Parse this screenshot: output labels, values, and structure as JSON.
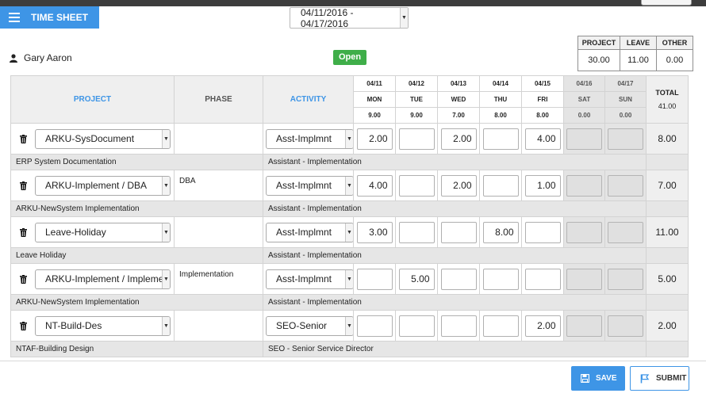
{
  "header": {
    "title": "TIME SHEET",
    "period": "04/11/2016 - 04/17/2016",
    "user": "Gary Aaron",
    "status": "Open"
  },
  "summary": {
    "labels": [
      "PROJECT",
      "LEAVE",
      "OTHER"
    ],
    "values": [
      "30.00",
      "11.00",
      "0.00"
    ]
  },
  "grid": {
    "columns": {
      "project": "PROJECT",
      "phase": "PHASE",
      "activity": "ACTIVITY",
      "total": "TOTAL"
    },
    "grand_total": "41.00",
    "days": [
      {
        "date": "04/11",
        "dow": "MON",
        "total": "9.00"
      },
      {
        "date": "04/12",
        "dow": "TUE",
        "total": "9.00"
      },
      {
        "date": "04/13",
        "dow": "WED",
        "total": "7.00"
      },
      {
        "date": "04/14",
        "dow": "THU",
        "total": "8.00"
      },
      {
        "date": "04/15",
        "dow": "FRI",
        "total": "8.00"
      },
      {
        "date": "04/16",
        "dow": "SAT",
        "total": "0.00"
      },
      {
        "date": "04/17",
        "dow": "SUN",
        "total": "0.00"
      }
    ],
    "rows": [
      {
        "project": "ARKU-SysDocument",
        "phase": "",
        "activity": "Asst-Implmnt",
        "hours": [
          "2.00",
          "",
          "2.00",
          "",
          "4.00",
          "",
          ""
        ],
        "total": "8.00",
        "project_desc": "ERP System Documentation",
        "activity_desc": "Assistant - Implementation"
      },
      {
        "project": "ARKU-Implement / DBA",
        "phase": "DBA",
        "activity": "Asst-Implmnt",
        "hours": [
          "4.00",
          "",
          "2.00",
          "",
          "1.00",
          "",
          ""
        ],
        "total": "7.00",
        "project_desc": "ARKU-NewSystem Implementation",
        "activity_desc": "Assistant - Implementation"
      },
      {
        "project": "Leave-Holiday",
        "phase": "",
        "activity": "Asst-Implmnt",
        "hours": [
          "3.00",
          "",
          "",
          "8.00",
          "",
          "",
          ""
        ],
        "total": "11.00",
        "project_desc": "Leave Holiday",
        "activity_desc": "Assistant - Implementation"
      },
      {
        "project": "ARKU-Implement / Implemen",
        "phase": "Implementation",
        "activity": "Asst-Implmnt",
        "hours": [
          "",
          "5.00",
          "",
          "",
          "",
          "",
          ""
        ],
        "total": "5.00",
        "project_desc": "ARKU-NewSystem Implementation",
        "activity_desc": "Assistant - Implementation"
      },
      {
        "project": "NT-Build-Des",
        "phase": "",
        "activity": "SEO-Senior",
        "hours": [
          "",
          "",
          "",
          "",
          "2.00",
          "",
          ""
        ],
        "total": "2.00",
        "project_desc": "NTAF-Building Design",
        "activity_desc": "SEO - Senior Service Director"
      }
    ]
  },
  "footer": {
    "save": "SAVE",
    "submit": "SUBMIT"
  },
  "icons": {
    "menu": "hamburger-icon",
    "user": "user-icon",
    "delete": "trash-icon",
    "dropdown": "chevron-down-icon",
    "save": "floppy-disk-icon",
    "submit": "flag-icon"
  },
  "colors": {
    "accent": "#3e95e6",
    "status_open": "#3fae49"
  }
}
